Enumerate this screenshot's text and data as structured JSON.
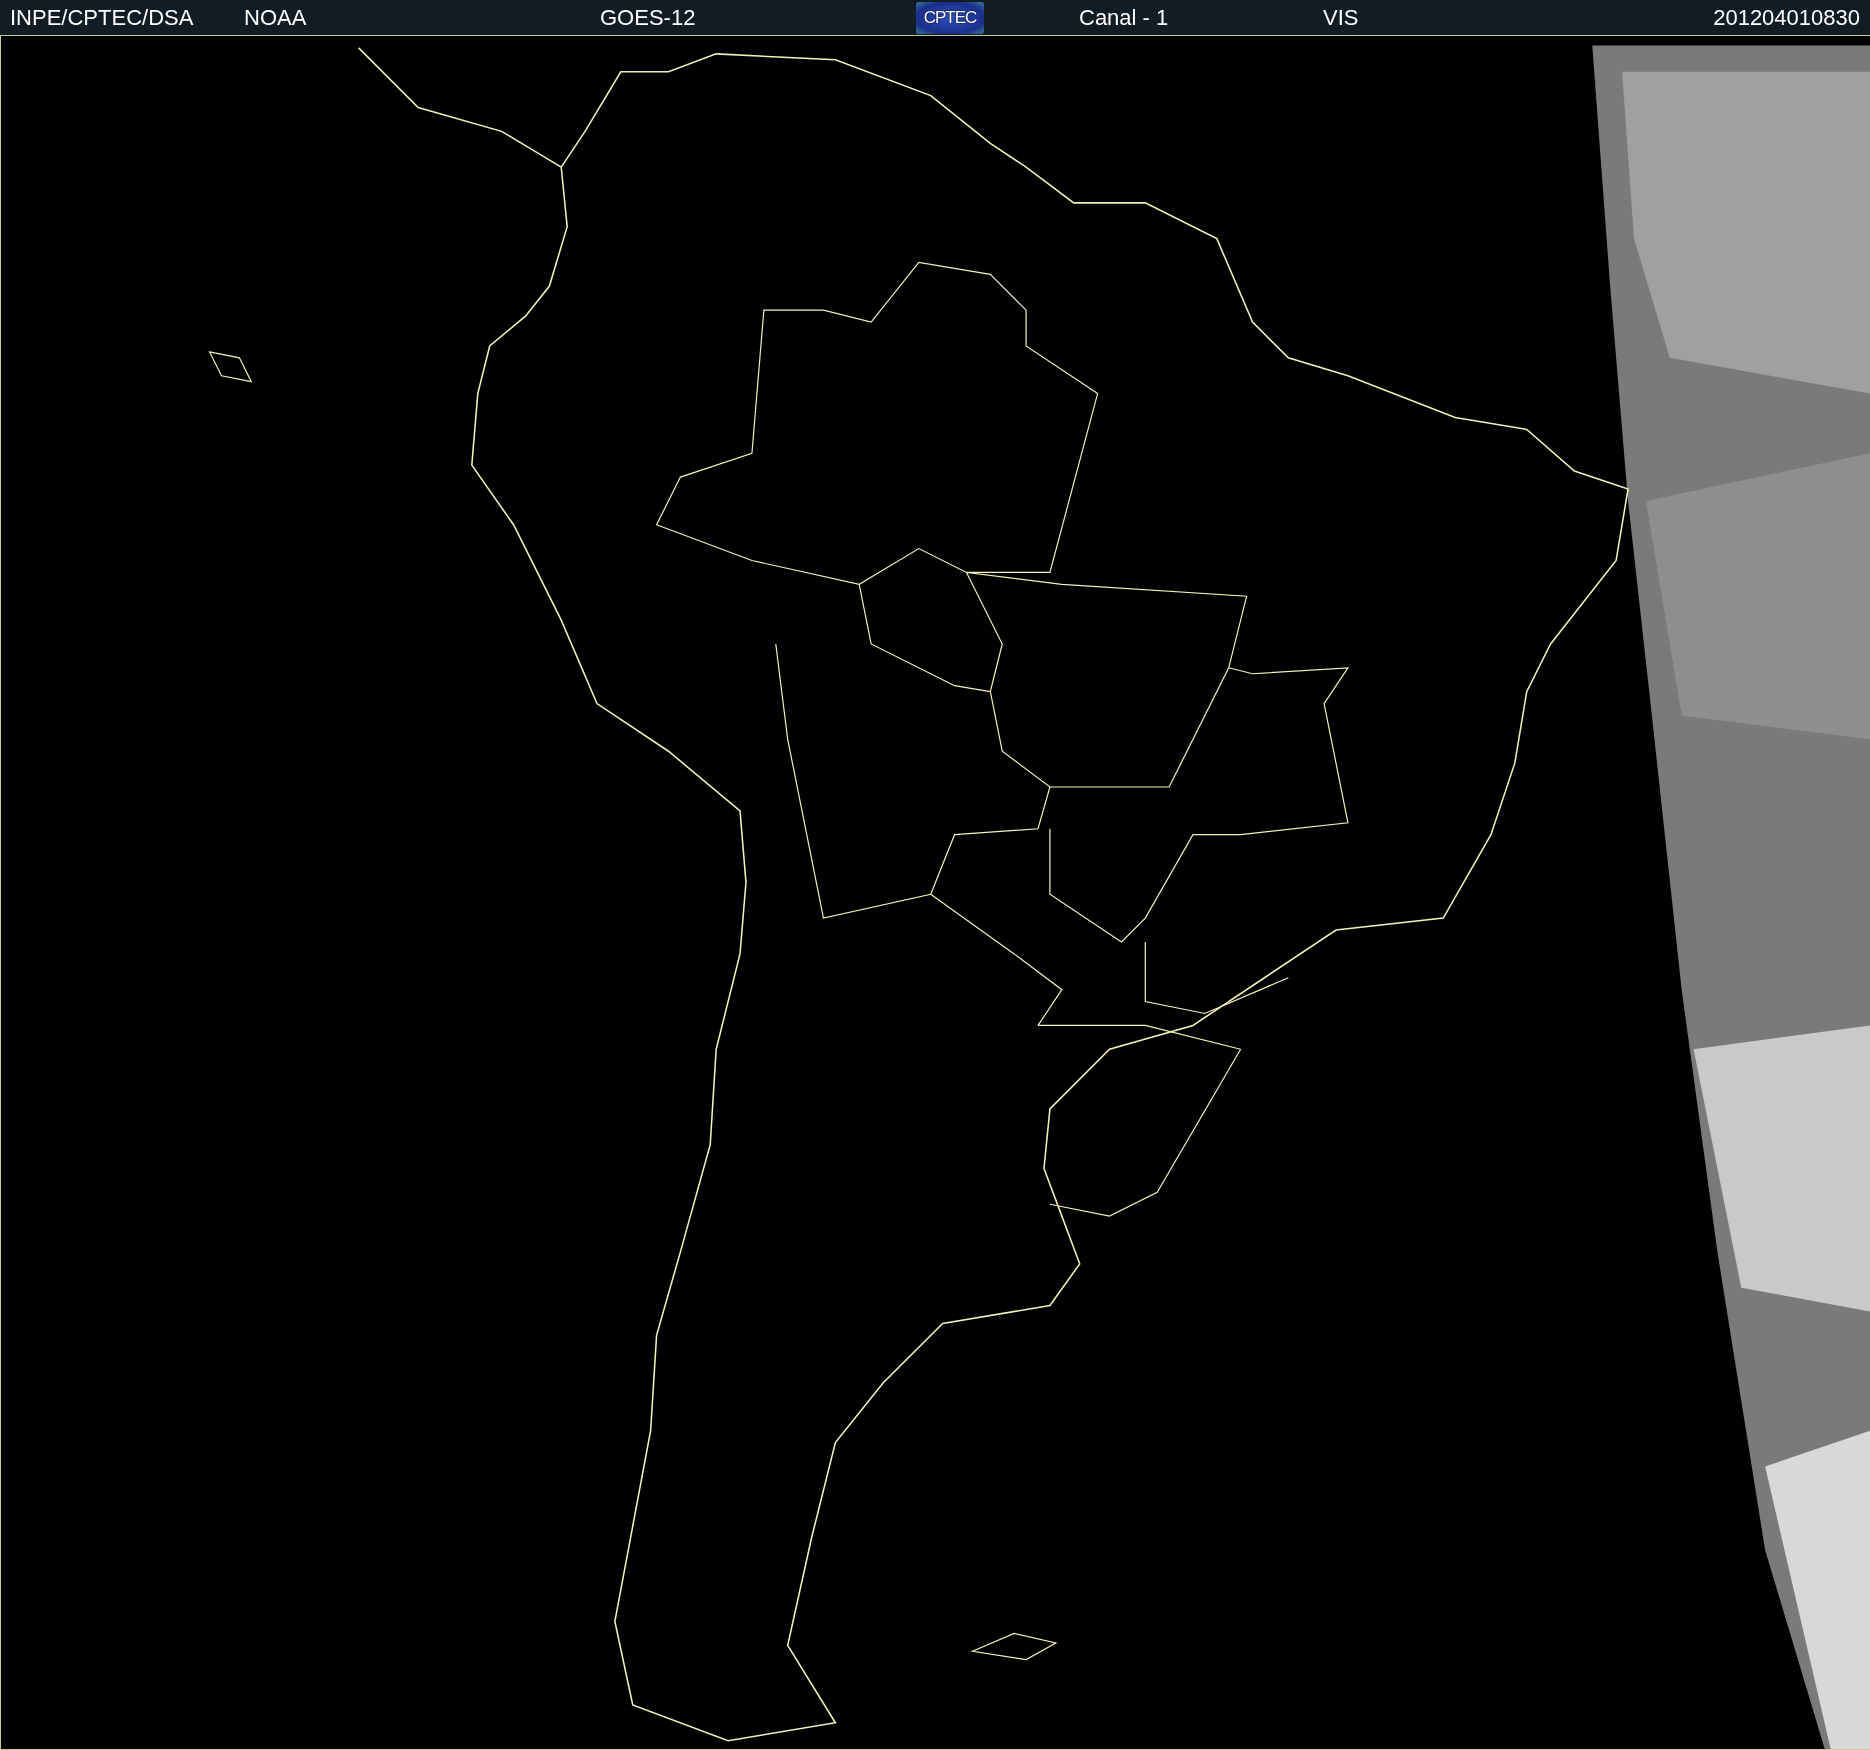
{
  "header": {
    "items": [
      {
        "kind": "text",
        "text": "INPE/CPTEC/DSA"
      },
      {
        "kind": "text",
        "text": "NOAA"
      },
      {
        "kind": "text",
        "text": "GOES-12"
      },
      {
        "kind": "logo",
        "text": "CPTEC"
      },
      {
        "kind": "text",
        "text": "Canal - 1"
      },
      {
        "kind": "text",
        "text": "VIS"
      },
      {
        "kind": "time",
        "text": "201204010830"
      }
    ]
  }
}
